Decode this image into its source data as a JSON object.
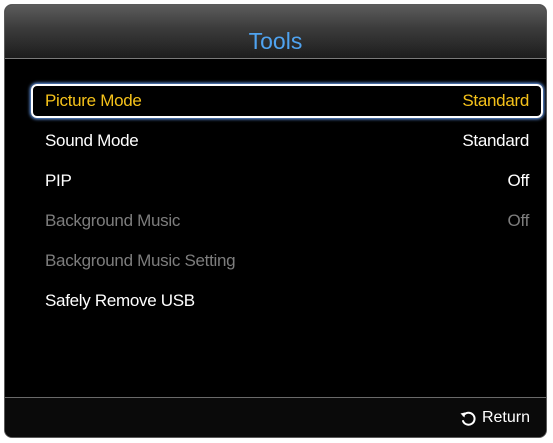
{
  "dialog": {
    "title": "Tools"
  },
  "menu": {
    "items": [
      {
        "label": "Picture Mode",
        "value": "Standard",
        "state": "selected"
      },
      {
        "label": "Sound Mode",
        "value": "Standard",
        "state": "enabled"
      },
      {
        "label": "PIP",
        "value": "Off",
        "state": "enabled"
      },
      {
        "label": "Background Music",
        "value": "Off",
        "state": "disabled"
      },
      {
        "label": "Background Music Setting",
        "value": "",
        "state": "disabled"
      },
      {
        "label": "Safely Remove USB",
        "value": "",
        "state": "enabled"
      }
    ]
  },
  "footer": {
    "return_label": "Return",
    "return_icon": "return-arrow-icon"
  },
  "colors": {
    "title": "#4fa3f0",
    "selected_text": "#f5c21a",
    "normal_text": "#ffffff",
    "disabled_text": "#7d7d7d",
    "background": "#000000",
    "focus_border": "#ffffff"
  }
}
